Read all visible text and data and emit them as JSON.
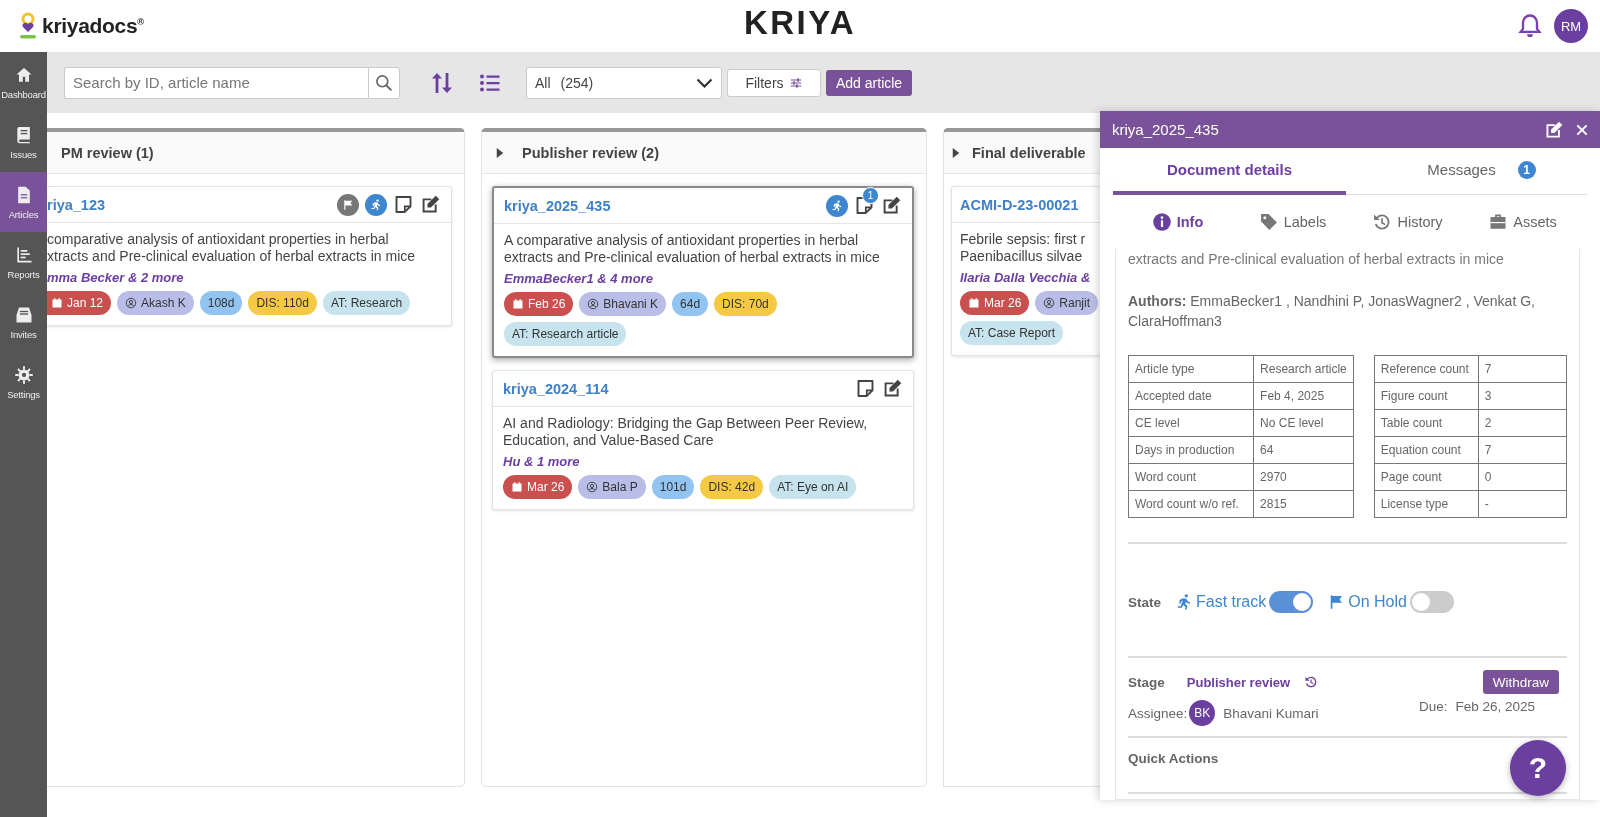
{
  "header": {
    "logo": "kriyadocs$^{®}$",
    "title": "KRIYA",
    "avatar": "RM"
  },
  "sidebar": {
    "items": [
      {
        "label": "Dashboard",
        "selected": false
      },
      {
        "label": "Issues",
        "selected": false
      },
      {
        "label": "Articles",
        "selected": true
      },
      {
        "label": "Reports",
        "selected": false
      },
      {
        "label": "Invites",
        "selected": false
      },
      {
        "label": "Settings",
        "selected": false
      }
    ]
  },
  "toolbar": {
    "search": {
      "placeholder": "Search by ID, article name"
    },
    "select": {
      "value": "All",
      "count": "(254)"
    },
    "filters_button": "Filters",
    "add_button": "Add article"
  },
  "columns": [
    {
      "title": "PM review (1)",
      "caret": false,
      "cards": [
        {
          "id": "riya_123",
          "selected": false,
          "icons": [
            {
              "kind": "flag"
            },
            {
              "kind": "fast_track"
            },
            {
              "kind": "note"
            },
            {
              "kind": "edit"
            }
          ],
          "title_lines": [
            "comparative analysis of antioxidant properties in herbal",
            "xtracts and Pre-clinical evaluation of herbal extracts in mice"
          ],
          "authors": "mma Becker & 2 more",
          "chips": [
            {
              "kind": "date",
              "text": "Jan 12"
            },
            {
              "kind": "person",
              "text": "Akash K"
            },
            {
              "kind": "days",
              "text": "108d"
            },
            {
              "kind": "dis",
              "text": "DIS: 110d"
            },
            {
              "kind": "type",
              "text": "AT: Research"
            }
          ]
        }
      ]
    },
    {
      "title": "Publisher review (2)",
      "caret": true,
      "cards": [
        {
          "id": "kriya_2025_435",
          "selected": true,
          "icons": [
            {
              "kind": "fast_track"
            },
            {
              "kind": "note",
              "badge": "1"
            },
            {
              "kind": "edit"
            }
          ],
          "title_lines": [
            "A comparative analysis of antioxidant properties in herbal",
            "extracts and Pre-clinical evaluation of herbal extracts in mice"
          ],
          "authors": "EmmaBecker1 & 4 more",
          "chips": [
            {
              "kind": "date",
              "text": "Feb 26"
            },
            {
              "kind": "person",
              "text": "Bhavani K"
            },
            {
              "kind": "days",
              "text": "64d"
            },
            {
              "kind": "dis",
              "text": "DIS: 70d"
            },
            {
              "kind": "type",
              "text": "AT: Research article"
            }
          ]
        },
        {
          "id": "kriya_2024_114",
          "selected": false,
          "icons": [
            {
              "kind": "note"
            },
            {
              "kind": "edit"
            }
          ],
          "title_lines": [
            "AI and Radiology: Bridging the Gap Between Peer Review,",
            "Education, and Value-Based Care"
          ],
          "authors": "Hu & 1 more",
          "chips": [
            {
              "kind": "date",
              "text": "Mar 26"
            },
            {
              "kind": "person",
              "text": "Bala P"
            },
            {
              "kind": "days",
              "text": "101d"
            },
            {
              "kind": "dis",
              "text": "DIS: 42d"
            },
            {
              "kind": "type",
              "text": "AT: Eye on AI"
            }
          ]
        }
      ]
    },
    {
      "title": "Final deliverable",
      "caret": true,
      "cards": [
        {
          "id": "ACMI-D-23-00021",
          "selected": false,
          "title_lines": [
            "Febrile sepsis: first r",
            "Paenibacillus silvae"
          ],
          "authors": "Ilaria Dalla Vecchia &",
          "chips": [
            {
              "kind": "date",
              "text": "Mar 26"
            },
            {
              "kind": "person",
              "text": "Ranjit"
            },
            {
              "kind": "type",
              "text": "AT: Case Report"
            }
          ]
        }
      ]
    }
  ],
  "panel": {
    "title": "kriya_2025_435",
    "tabs": [
      {
        "label": "Document details",
        "selected": true
      },
      {
        "label": "Messages",
        "selected": false,
        "badge": "1"
      }
    ],
    "subtabs": [
      {
        "label": "Info",
        "selected": true
      },
      {
        "label": "Labels",
        "selected": false
      },
      {
        "label": "History",
        "selected": false
      },
      {
        "label": "Assets",
        "selected": false
      }
    ],
    "title_fragment": "extracts and Pre-clinical evaluation of herbal extracts in mice",
    "authors": "**Authors:** EmmaBecker1 , Nandhini P, JonasWagner2 , Venkat G, ClaraHoffman3",
    "tables": [
      [
        [
          "Article type",
          "Research article"
        ],
        [
          "Accepted date",
          "Feb 4, 2025"
        ],
        [
          "CE level",
          "No CE level"
        ],
        [
          "Days in production",
          "64"
        ],
        [
          "Word count",
          "2970"
        ],
        [
          "Word count w/o ref.",
          "2815"
        ]
      ],
      [
        [
          "Reference count",
          "7"
        ],
        [
          "Figure count",
          "3"
        ],
        [
          "Table count",
          "2"
        ],
        [
          "Equation count",
          "7"
        ],
        [
          "Page count",
          "0"
        ],
        [
          "License type",
          "-"
        ]
      ]
    ],
    "state": {
      "label": "State",
      "toggles": [
        {
          "label": "Fast track",
          "on": true
        },
        {
          "label": "On Hold",
          "on": false
        }
      ]
    },
    "stage": {
      "label": "Stage",
      "value": "Publisher review",
      "button": "Withdraw",
      "assignee_label": "Assignee:",
      "assignee_initials": "BK",
      "assignee": "Bhavani Kumari",
      "due_label": "Due:",
      "due": "Feb 26, 2025"
    },
    "quick_actions": "Quick Actions"
  },
  "help_button": "?"
}
